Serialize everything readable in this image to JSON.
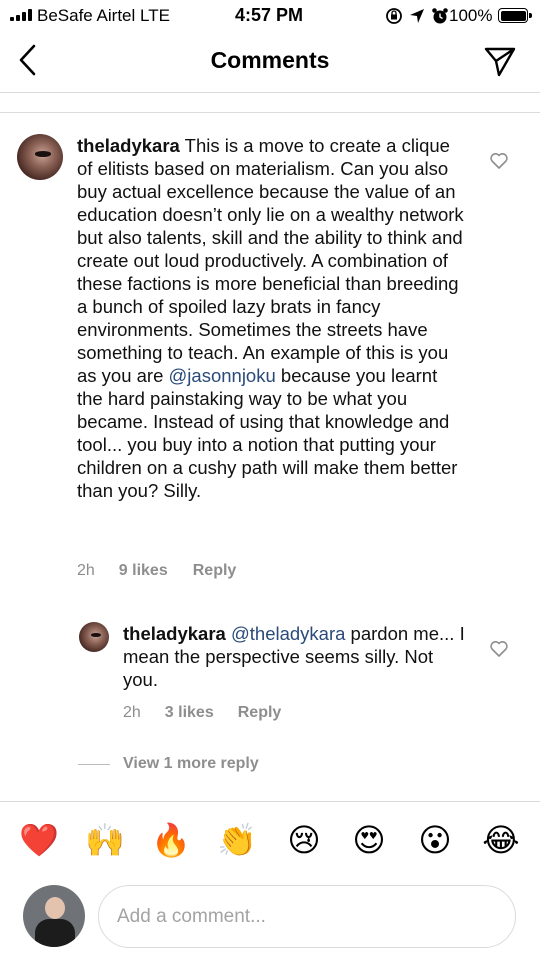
{
  "status_bar": {
    "carrier": "BeSafe Airtel  LTE",
    "time": "4:57 PM",
    "battery": "100%"
  },
  "header": {
    "title": "Comments"
  },
  "comments": [
    {
      "username": "theladykara",
      "text_part1": " This is a move to create a clique of elitists based on materialism. Can you also buy actual excellence because the value of an education doesn’t only lie on a wealthy network but also talents, skill and the ability to think and create out loud productively. A combination of these factions is more beneficial than breeding a bunch of spoiled lazy brats in fancy environments. Sometimes the streets have something to teach. An example of this is you as you are ",
      "mention": "@jasonnjoku",
      "text_part2": " because you learnt the hard painstaking way to be what you became. Instead of using that knowledge and tool... you buy into a notion that putting your children on a cushy path will make them better than you? Silly.",
      "time": "2h",
      "likes": "9 likes",
      "reply": "Reply"
    }
  ],
  "replies": [
    {
      "username": "theladykara",
      "mention": "@theladykara",
      "text": " pardon me... I mean the perspective seems silly. Not you.",
      "time": "2h",
      "likes": "3 likes",
      "reply": "Reply"
    }
  ],
  "view_more": "View 1 more reply",
  "emojis": [
    "❤️",
    "🙌",
    "🔥",
    "👏",
    "😢",
    "😍",
    "😮",
    "😂"
  ],
  "composer": {
    "placeholder": "Add a comment..."
  },
  "colors": {
    "mention": "#2b4a7a",
    "meta": "#8e8e8e",
    "divider": "#dbdbdb"
  }
}
